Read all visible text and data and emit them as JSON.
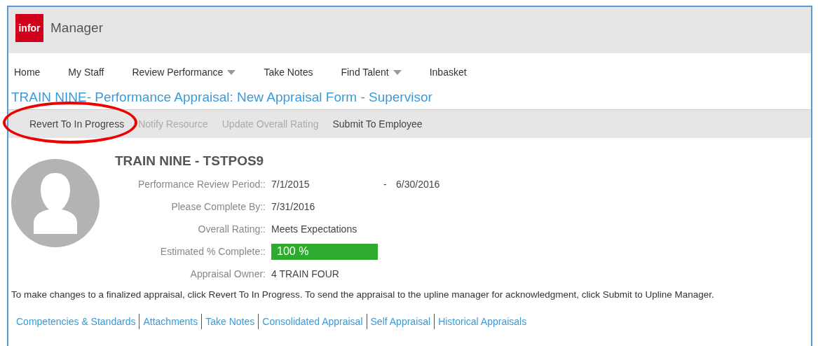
{
  "header": {
    "logo": "infor",
    "title": "Manager"
  },
  "nav": [
    {
      "label": "Home",
      "dropdown": false
    },
    {
      "label": "My Staff",
      "dropdown": false
    },
    {
      "label": "Review Performance",
      "dropdown": true
    },
    {
      "label": "Take Notes",
      "dropdown": false
    },
    {
      "label": "Find Talent",
      "dropdown": true
    },
    {
      "label": "Inbasket",
      "dropdown": false
    }
  ],
  "page_title": "TRAIN NINE- Performance Appraisal: New Appraisal Form - Supervisor",
  "actions": [
    {
      "label": "Revert To In Progress",
      "disabled": false,
      "highlighted": true
    },
    {
      "label": "Notify Resource",
      "disabled": true,
      "highlighted": false
    },
    {
      "label": "Update Overall Rating",
      "disabled": true,
      "highlighted": false
    },
    {
      "label": "Submit To Employee",
      "disabled": false,
      "highlighted": false
    }
  ],
  "employee": {
    "name": "TRAIN NINE - TSTPOS9",
    "fields": [
      {
        "kind": "range",
        "label": "Performance Review Period::",
        "value": "7/1/2015",
        "separator": "-",
        "value_end": "6/30/2016"
      },
      {
        "kind": "text",
        "label": "Please Complete By::",
        "value": "7/31/2016"
      },
      {
        "kind": "text",
        "label": "Overall Rating::",
        "value": "Meets Expectations"
      },
      {
        "kind": "progress",
        "label": "Estimated % Complete::",
        "value": "100 %",
        "level": 1
      },
      {
        "kind": "text",
        "label": "Appraisal Owner:",
        "value": "4 TRAIN FOUR"
      }
    ]
  },
  "instructions": "To make changes to a finalized appraisal, click Revert To In Progress. To send the appraisal to the upline manager for acknowledgment, click Submit to Upline Manager.",
  "tabs": [
    "Competencies & Standards",
    "Attachments",
    "Take Notes",
    "Consolidated Appraisal",
    "Self Appraisal",
    "Historical Appraisals"
  ]
}
